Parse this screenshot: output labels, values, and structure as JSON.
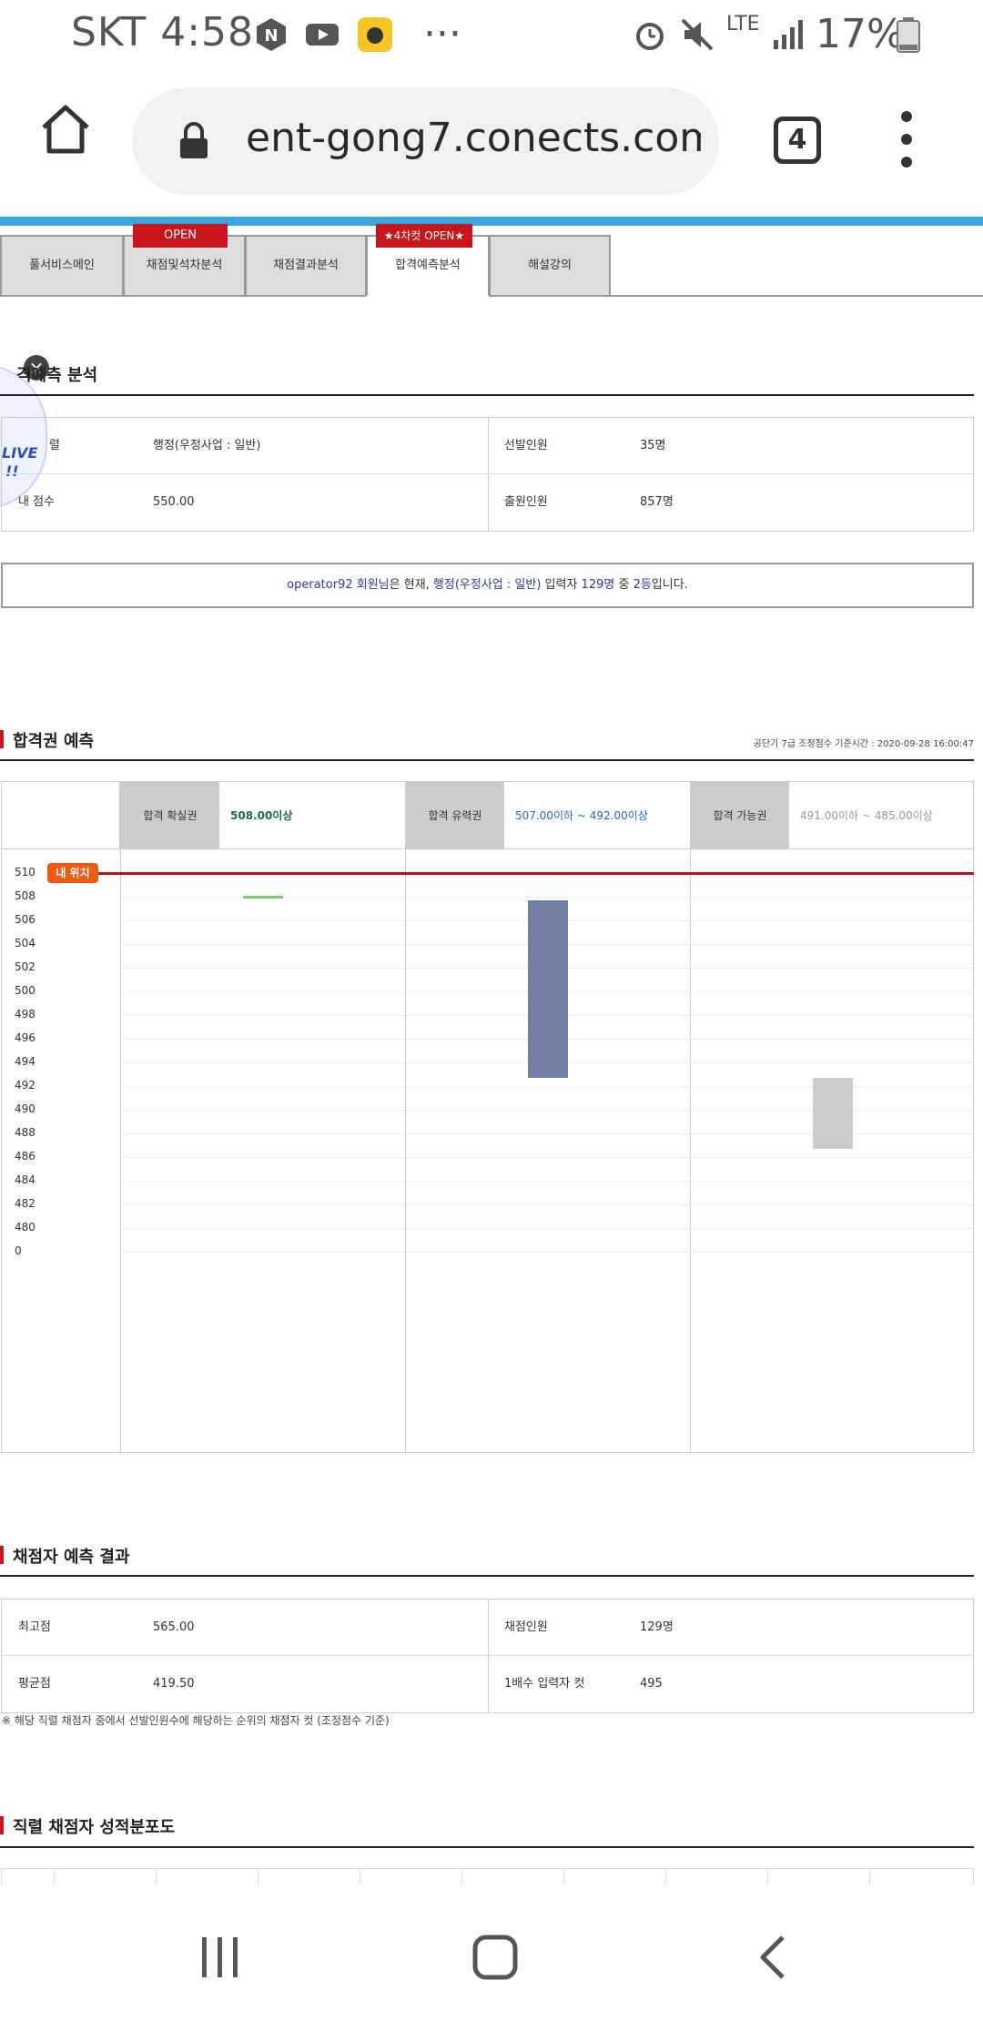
{
  "status_bar": {
    "carrier_time": "SKT 4:58",
    "network": "LTE",
    "battery": "17%",
    "more": "···",
    "icons": [
      "naver-icon",
      "youtube-icon",
      "bee-app-icon",
      "alarm-icon",
      "mute-icon",
      "signal-icon",
      "battery-icon"
    ]
  },
  "browser": {
    "url": "ent-gong7.conects.com",
    "tab_count": "4"
  },
  "tabs": [
    {
      "label": "풀서비스메인",
      "badge": ""
    },
    {
      "label": "채점및석차분석",
      "badge": "OPEN"
    },
    {
      "label": "채점결과분석",
      "badge": ""
    },
    {
      "label": "합격예측분석",
      "badge": "★4차컷 OPEN★"
    },
    {
      "label": "해설강의",
      "badge": ""
    }
  ],
  "analysis": {
    "title": "합격예측 분석",
    "title_visible": "격예측 분석",
    "rows": [
      {
        "l1": "렬",
        "v1": "행정(우정사업 : 일반)",
        "l2": "선발인원",
        "v2": "35명"
      },
      {
        "l1": "내 점수",
        "v1": "550.00",
        "l2": "출원인원",
        "v2": "857명"
      }
    ],
    "side_banner": [
      "LIVE",
      "!!"
    ]
  },
  "notice": {
    "user": "operator92",
    "t1": " 회원님",
    "t2": "은 현재, ",
    "job": "행정(우정사업 : 일반)",
    "t3": " 입력자 ",
    "count": "129명",
    "t4": " 중 ",
    "rank": "2등",
    "t5": "입니다."
  },
  "prediction": {
    "title": "합격권 예측",
    "reference": "공단기 7급 조정점수 기준시간 : 2020-09-28 16:00:47",
    "zones": [
      {
        "label": "합격 확실권",
        "value": "508.00이상",
        "color": "#1f6b4a"
      },
      {
        "label": "합격 유력권",
        "value": "507.00이하 ~ 492.00이상",
        "color": "#2d63b8"
      },
      {
        "label": "합격 가능권",
        "value": "491.00이하 ~ 485.00이상",
        "color": "#999999"
      }
    ],
    "my_position_label": "내 위치"
  },
  "chart_data": {
    "type": "bar",
    "categories": [
      "합격 확실권",
      "합격 유력권",
      "합격 가능권"
    ],
    "ranges": [
      {
        "low": 508,
        "high": 508,
        "color": "#7ccc7c"
      },
      {
        "low": 493,
        "high": 508,
        "color": "#6f7fa6"
      },
      {
        "low": 487,
        "high": 493,
        "color": "#cccccc"
      }
    ],
    "my_position": 510,
    "y_ticks": [
      "510",
      "508",
      "506",
      "504",
      "502",
      "500",
      "498",
      "496",
      "494",
      "492",
      "490",
      "488",
      "486",
      "484",
      "482",
      "480",
      "0"
    ],
    "ylim": [
      480,
      510
    ]
  },
  "graders": {
    "title": "채점자 예측 결과",
    "rows": [
      {
        "l1": "최고점",
        "v1": "565.00",
        "l2": "채점인원",
        "v2": "129명"
      },
      {
        "l1": "평균점",
        "v1": "419.50",
        "l2": "1배수 입력자 컷",
        "v2": "495"
      }
    ],
    "footnote": "※ 해당 직렬 채점자 중에서 선발인원수에 해당하는 순위의 채점자 컷 (조정점수 기준)"
  },
  "distribution": {
    "title": "직렬 채점자 성적분포도"
  }
}
